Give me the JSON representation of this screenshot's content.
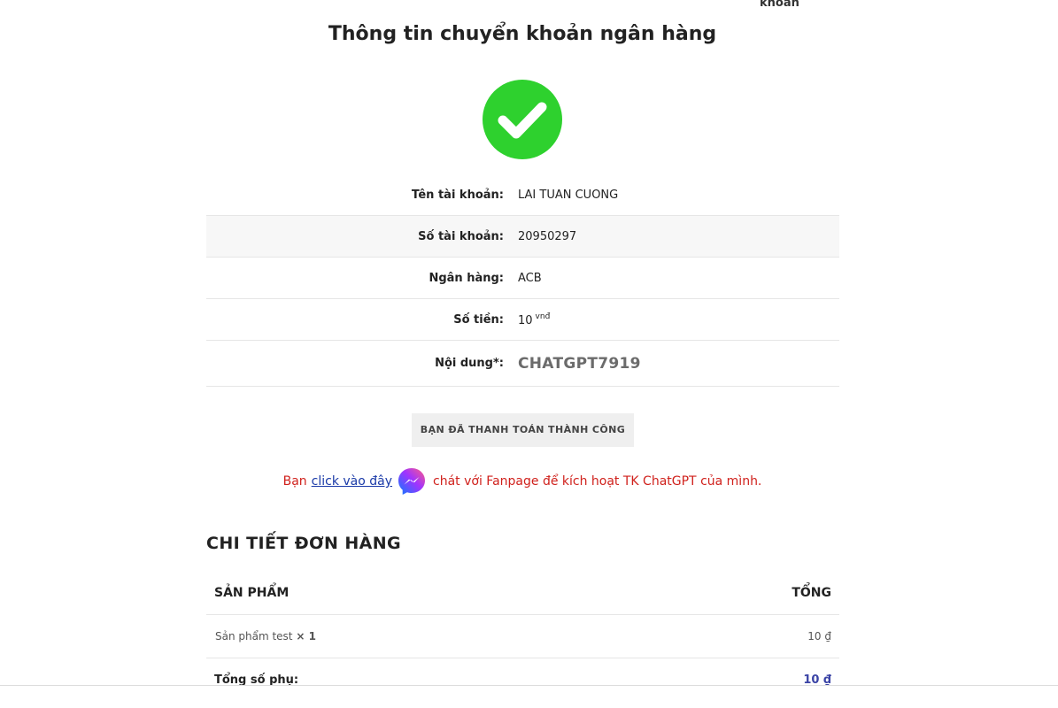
{
  "top_cut_text": "khoản",
  "title": "Thông tin chuyển khoản ngân hàng",
  "status_icon_color": "#2ed12e",
  "bank_info": [
    {
      "label": "Tên tài khoản:",
      "value": "LAI TUAN CUONG"
    },
    {
      "label": "Số tài khoản:",
      "value": "20950297"
    },
    {
      "label": "Ngân hàng:",
      "value": "ACB"
    },
    {
      "label": "Số tiền:",
      "value": "10",
      "unit": "vnđ"
    },
    {
      "label": "Nội dung*:",
      "value": "CHATGPT7919"
    }
  ],
  "paid_button_label": "BẠN ĐÃ THANH TOÁN THÀNH CÔNG",
  "fanpage": {
    "prefix": "Bạn",
    "link_text": "click vào đây",
    "icon": "messenger-icon",
    "suffix": "chát với Fanpage để kích hoạt TK ChatGPT của mình."
  },
  "order": {
    "heading": "CHI TIẾT ĐƠN HÀNG",
    "col_product": "SẢN PHẨM",
    "col_total": "TỔNG",
    "items": [
      {
        "name": "Sản phẩm test",
        "qty": "× 1",
        "total": "10 ₫"
      }
    ],
    "subtotal_label": "Tổng số phụ:",
    "subtotal_value": "10 ₫"
  },
  "colors": {
    "accent_link": "#1a3aa8",
    "note_text": "#d0211c",
    "subtotal_amount": "#3b44a6"
  }
}
